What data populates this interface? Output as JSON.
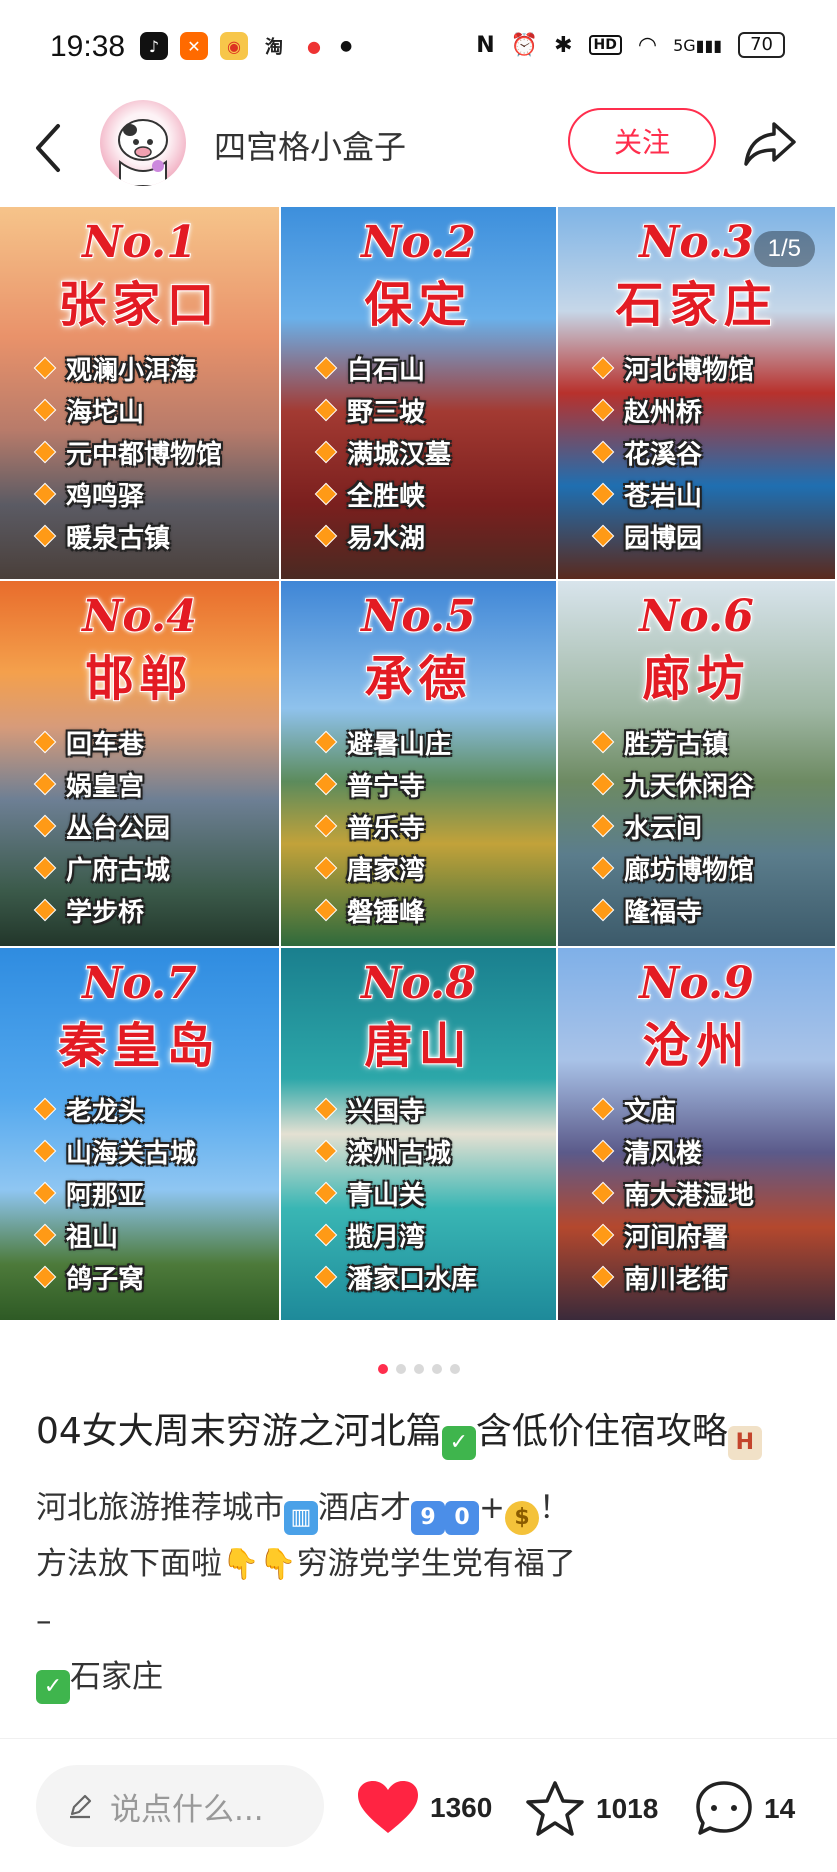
{
  "status_bar": {
    "time": "19:38",
    "apps": [
      "douyin",
      "app-x",
      "weibo",
      "taobao",
      "maps"
    ],
    "taobao_label": "淘",
    "network": "5G",
    "battery": "70"
  },
  "header": {
    "author": "四宫格小盒子",
    "follow_label": "关注"
  },
  "gallery": {
    "counter": "1/5",
    "cells": [
      {
        "no": "No.1",
        "city": "张家口",
        "spots": [
          "观澜小洱海",
          "海坨山",
          "元中都博物馆",
          "鸡鸣驿",
          "暖泉古镇"
        ],
        "bg": "linear-gradient(180deg,#f6c48a 0%,#e9926a 35%,#b87b6a 60%,#5b5b64 80%,#4a3f3a 100%)"
      },
      {
        "no": "No.2",
        "city": "保定",
        "spots": [
          "白石山",
          "野三坡",
          "满城汉墓",
          "全胜峡",
          "易水湖"
        ],
        "bg": "linear-gradient(180deg,#3d8fdc 0%,#6ab0ea 30%,#a33a32 55%,#7a1f1e 80%,#4a2a22 100%)"
      },
      {
        "no": "No.3",
        "city": "石家庄",
        "spots": [
          "河北博物馆",
          "赵州桥",
          "花溪谷",
          "苍岩山",
          "园博园"
        ],
        "bg": "linear-gradient(180deg,#7fb4e6 0%,#c6d7e8 28%,#b8312c 50%,#1f6fb1 75%,#5a2a1e 100%)"
      },
      {
        "no": "No.4",
        "city": "邯郸",
        "spots": [
          "回车巷",
          "娲皇宫",
          "丛台公园",
          "广府古城",
          "学步桥"
        ],
        "bg": "linear-gradient(180deg,#e86c2c 0%,#f4a04c 25%,#d79b7a 40%,#6d7f94 60%,#3b5a4a 85%,#22362a 100%)"
      },
      {
        "no": "No.5",
        "city": "承德",
        "spots": [
          "避暑山庄",
          "普宁寺",
          "普乐寺",
          "唐家湾",
          "磐锤峰"
        ],
        "bg": "linear-gradient(180deg,#3f86d6 0%,#8fc2ec 35%,#5c8b5c 55%,#c2a23a 72%,#2f6a3c 100%)"
      },
      {
        "no": "No.6",
        "city": "廊坊",
        "spots": [
          "胜芳古镇",
          "九天休闲谷",
          "水云间",
          "廊坊博物馆",
          "隆福寺"
        ],
        "bg": "linear-gradient(180deg,#d8e4ec 0%,#9fb7a4 35%,#6d8a62 55%,#5b7d8c 75%,#3c5a6a 100%)"
      },
      {
        "no": "No.7",
        "city": "秦皇岛",
        "spots": [
          "老龙头",
          "山海关古城",
          "阿那亚",
          "祖山",
          "鸽子窝"
        ],
        "bg": "linear-gradient(180deg,#2f8ce0 0%,#53a8ee 40%,#8fc6f2 65%,#4d7a3a 85%,#2e5a25 100%)"
      },
      {
        "no": "No.8",
        "city": "唐山",
        "spots": [
          "兴国寺",
          "滦州古城",
          "青山关",
          "揽月湾",
          "潘家口水库"
        ],
        "bg": "linear-gradient(180deg,#1a7f8e 0%,#2ca7a9 35%,#e4e0d2 50%,#39b6b4 70%,#1e8a9a 100%)"
      },
      {
        "no": "No.9",
        "city": "沧州",
        "spots": [
          "文庙",
          "清风楼",
          "南大港湿地",
          "河间府署",
          "南川老街"
        ],
        "bg": "linear-gradient(180deg,#7fb0e8 0%,#a9c3e8 30%,#5b5a8a 55%,#b4482e 75%,#3a2a3a 100%)"
      }
    ],
    "dot_count": 5,
    "active_dot": 0
  },
  "post": {
    "title_text": "04女大周末穷游之河北篇",
    "title_text_2": "含低价住宿攻略",
    "body_line1_a": "河北旅游推荐城市",
    "body_line1_b": "酒店才",
    "num_9": "9",
    "num_0": "0",
    "plus": "+",
    "body_line1_c": "！",
    "body_line2_a": "方法放下面啦",
    "body_line2_b": "穷游党学生党有福了",
    "body_line3": "–",
    "body_line4": "石家庄"
  },
  "bottom_bar": {
    "comment_placeholder": "说点什么...",
    "likes": "1360",
    "favorites": "1018",
    "comments": "14"
  },
  "colors": {
    "accent": "#ff2e4d",
    "title_red": "#e31b23",
    "diamond": "#ff9a16"
  }
}
